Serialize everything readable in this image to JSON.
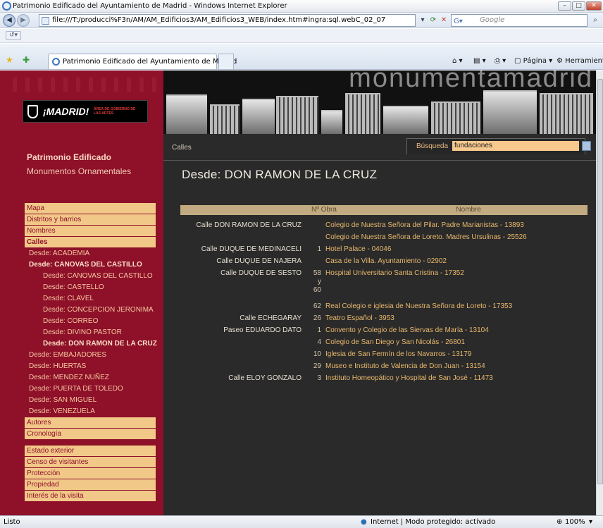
{
  "window": {
    "title": "Patrimonio Edificado del Ayuntamiento de Madrid - Windows Internet Explorer",
    "url": "file:///T:/producci%F3n/AM/AM_Edificios3/AM_Edificios3_WEB/index.htm#ingra:sql.webC_02_07",
    "search_placeholder": "Google",
    "tab_title": "Patrimonio Edificado del Ayuntamiento de Madrid",
    "tools": {
      "page": "Página",
      "tools": "Herramientas"
    },
    "status_left": "Listo",
    "status_zone": "Internet | Modo protegido: activado",
    "zoom": "100%"
  },
  "site": {
    "logo_text": "¡MADRID!",
    "logo_area": "ÁREA DE GOBIERNO DE LAS ARTES",
    "banner_word": "monumentamadrid",
    "section_primary": "Patrimonio Edificado",
    "section_secondary": "Monumentos Ornamentales",
    "menu": [
      {
        "label": "Mapa",
        "style": "box"
      },
      {
        "label": "Distritos y barrios",
        "style": "box"
      },
      {
        "label": "Nombres",
        "style": "box"
      },
      {
        "label": "Calles",
        "style": "box sel"
      },
      {
        "label": "Desde: ACADEMIA",
        "style": "l1"
      },
      {
        "label": "Desde: CANOVAS DEL CASTILLO",
        "style": "l1 bold"
      },
      {
        "label": "Desde: CANOVAS DEL CASTILLO",
        "style": "l2"
      },
      {
        "label": "Desde: CASTELLO",
        "style": "l2"
      },
      {
        "label": "Desde: CLAVEL",
        "style": "l2"
      },
      {
        "label": "Desde: CONCEPCION JERONIMA",
        "style": "l2"
      },
      {
        "label": "Desde: CORREO",
        "style": "l2"
      },
      {
        "label": "Desde: DIVINO PASTOR",
        "style": "l2"
      },
      {
        "label": "Desde: DON RAMON DE LA CRUZ",
        "style": "l2 bold"
      },
      {
        "label": "Desde: EMBAJADORES",
        "style": "l1"
      },
      {
        "label": "Desde: HUERTAS",
        "style": "l1"
      },
      {
        "label": "Desde: MENDEZ NUÑEZ",
        "style": "l1"
      },
      {
        "label": "Desde: PUERTA DE TOLEDO",
        "style": "l1"
      },
      {
        "label": "Desde: SAN MIGUEL",
        "style": "l1"
      },
      {
        "label": "Desde: VENEZUELA",
        "style": "l1"
      },
      {
        "label": "Autores",
        "style": "box"
      },
      {
        "label": "Cronología",
        "style": "box"
      },
      {
        "label": "",
        "style": "gap"
      },
      {
        "label": "Estado exterior",
        "style": "box"
      },
      {
        "label": "Censo de visitantes",
        "style": "box"
      },
      {
        "label": "Protección",
        "style": "box"
      },
      {
        "label": "Propiedad",
        "style": "box"
      },
      {
        "label": "Interés de la visita",
        "style": "box"
      }
    ]
  },
  "main": {
    "breadcrumb": "Calles",
    "search_label": "Búsqueda",
    "search_value": "fundaciones",
    "title": "Desde: DON RAMON DE LA CRUZ",
    "columns": {
      "name": "Nombre",
      "num": "Nº Obra"
    },
    "rows": [
      {
        "name": "Calle DON RAMON DE LA CRUZ",
        "num": "",
        "obra": "Colegio de Nuestra Señora del Pilar. Padre Marianistas - 13893"
      },
      {
        "name": "",
        "num": "",
        "obra": "Colegio de Nuestra Señora de Loreto. Madres Ursulinas - 25526"
      },
      {
        "name": "Calle DUQUE DE MEDINACELI",
        "num": "1",
        "obra": "Hotel Palace - 04046"
      },
      {
        "name": "Calle DUQUE DE NAJERA",
        "num": "",
        "obra": "Casa de la Villa. Ayuntamiento - 02902"
      },
      {
        "name": "Calle DUQUE DE SESTO",
        "num": "58\ny\n60",
        "obra": "Hospital Universitario Santa Cristina - 17352"
      },
      {
        "name": "",
        "num": "62",
        "obra": "Real Colegio e iglesia de Nuestra Señora de Loreto - 17353"
      },
      {
        "name": "Calle ECHEGARAY",
        "num": "26",
        "obra": "Teatro Español - 3953"
      },
      {
        "name": "Paseo EDUARDO DATO",
        "num": "1",
        "obra": "Convento y Colegio de las Siervas de María - 13104"
      },
      {
        "name": "",
        "num": "4",
        "obra": "Colegio de San Diego y San Nicolás - 26801"
      },
      {
        "name": "",
        "num": "10",
        "obra": "Iglesia de San Fermín de los Navarros - 13179"
      },
      {
        "name": "",
        "num": "29",
        "obra": "Museo e Instituto de Valencia de Don Juan - 13154"
      },
      {
        "name": "Calle ELOY GONZALO",
        "num": "3",
        "obra": "Instituto Homeopático y Hospital de San José - 11473"
      }
    ]
  },
  "colors": {
    "sidebar": "#8e1029",
    "accent": "#f2c889",
    "link": "#e8b86d",
    "background": "#2a2a2a"
  }
}
